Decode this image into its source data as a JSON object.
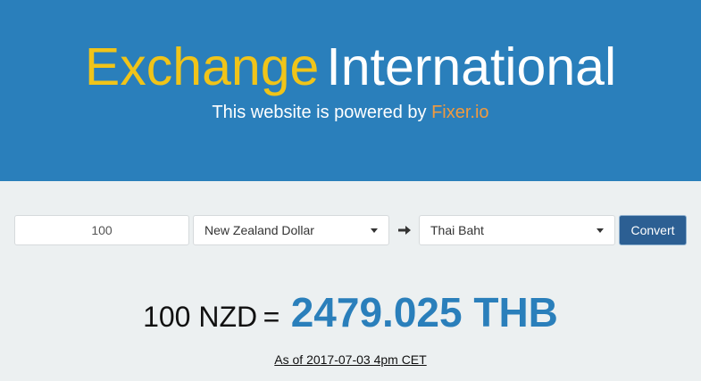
{
  "header": {
    "brand_part1": "Exchange",
    "brand_part2": "International",
    "tagline_prefix": "This website is powered by ",
    "tagline_link": "Fixer.io",
    "colors": {
      "background": "#2a7fbb",
      "brand_part1": "#f0c419",
      "brand_part2": "#ffffff",
      "link": "#f19a3e"
    }
  },
  "converter": {
    "amount_value": "100",
    "from_currency": "New Zealand Dollar",
    "arrow_icon": "arrow-right-icon",
    "to_currency": "Thai Baht",
    "convert_label": "Convert"
  },
  "result": {
    "lhs": "100 NZD",
    "equals": "=",
    "rhs": "2479.025 THB",
    "as_of": "As of 2017-07-03 4pm CET"
  }
}
